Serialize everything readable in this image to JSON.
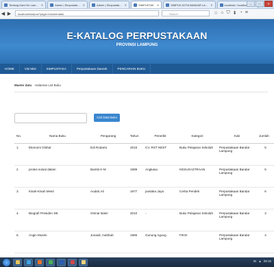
{
  "browser": {
    "tabs": [
      {
        "label": "Tentang Kami Ke Lam..."
      },
      {
        "label": "Admin | Simpustak..."
      },
      {
        "label": "Admin | Simpustak..."
      },
      {
        "label": "SIMPUSTAK"
      },
      {
        "label": "SIMPUS KOTA BANDAR LA..."
      },
      {
        "label": "localhost / localhost..."
      }
    ],
    "url": "localhost/simpus/?page=rekomendasi",
    "search_placeholder": "Search",
    "window_controls": {
      "minimize": "–",
      "maximize": "□",
      "close": "✕"
    },
    "toolbar_icons": [
      "star-icon",
      "home-icon",
      "shield-icon",
      "download-icon",
      "history-icon",
      "menu-icon"
    ]
  },
  "site": {
    "title": "E-KATALOG PERPUSTAKAAN",
    "subtitle": "PROVINSI LAMPUNG",
    "brand_color": "#3f89cf",
    "menu": [
      "HOME",
      "Visi Misi",
      "SIMPUSTAKA",
      "Perpustakaan Daerah",
      "PENCARIAN BUKU"
    ]
  },
  "breadcrumb": {
    "section": "Master data",
    "page": "Halaman List Buku"
  },
  "search": {
    "button": "Cari Data Buku",
    "value": ""
  },
  "table": {
    "headers": [
      "No.",
      "Nama Buku",
      "Pengarang",
      "Tahun",
      "Penerbit",
      "Kategori",
      "Kab",
      "Jumlah"
    ],
    "rows": [
      [
        "1.",
        "Ekonomi Global",
        "Edi Rodarto",
        "2015",
        "CV. RST NEST",
        "Buku Pelajaran Sekolah",
        "Perpustakaan Bandar Lampung",
        "5"
      ],
      [
        "2",
        "protes sosial dalam",
        "Bambi K-M",
        "1989",
        "Angkasa",
        "KESUSASTRAAN",
        "Perpustakaan Bandar Lampung",
        "5"
      ],
      [
        "3.",
        "Kisah-Kisah Mesir",
        "Audah,Ali",
        "1977",
        "pustaka Jaya",
        "Cerita Pendek",
        "Perpustakaan Bandar Lampung",
        "6"
      ],
      [
        "4.",
        "Biografi Presiden SB",
        "Osmar Bakri",
        "2010",
        "-",
        "Buku Pelajaran Sekolah",
        "Perpustakaan Bandar Lampung",
        "3"
      ],
      [
        "5.",
        "Angin Musim",
        "Junaidi, mahbub",
        "1965",
        "Gunung Agung",
        "FIKSI",
        "Perpustakaan Bandar Lampung",
        "4"
      ]
    ]
  },
  "taskbar": {
    "tray_text": [
      "IN",
      "▲",
      "09:15"
    ]
  }
}
